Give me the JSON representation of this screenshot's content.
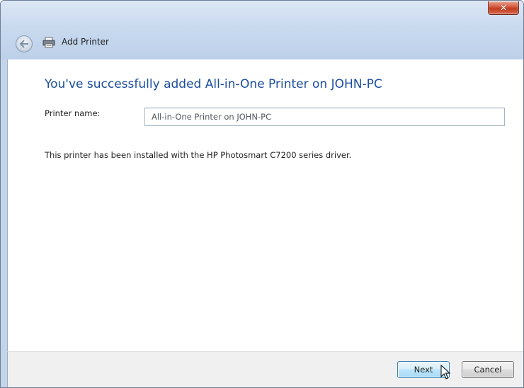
{
  "window": {
    "title": "Add Printer",
    "close_glyph": "✕"
  },
  "icons": {
    "back": "back-arrow-icon",
    "printer": "printer-icon",
    "close": "close-icon",
    "cursor": "mouse-pointer-icon"
  },
  "main": {
    "instruction": "You've successfully added All-in-One Printer on JOHN-PC",
    "printer_name_label": "Printer name:",
    "printer_name_value": "All-in-One Printer on JOHN-PC",
    "info": "This printer has been installed with the HP Photosmart C7200 series driver."
  },
  "footer": {
    "next_label": "Next",
    "cancel_label": "Cancel"
  },
  "colors": {
    "accent_text": "#1c4ea0",
    "frame": "#c4d5ea",
    "close_button": "#c23a1e"
  }
}
